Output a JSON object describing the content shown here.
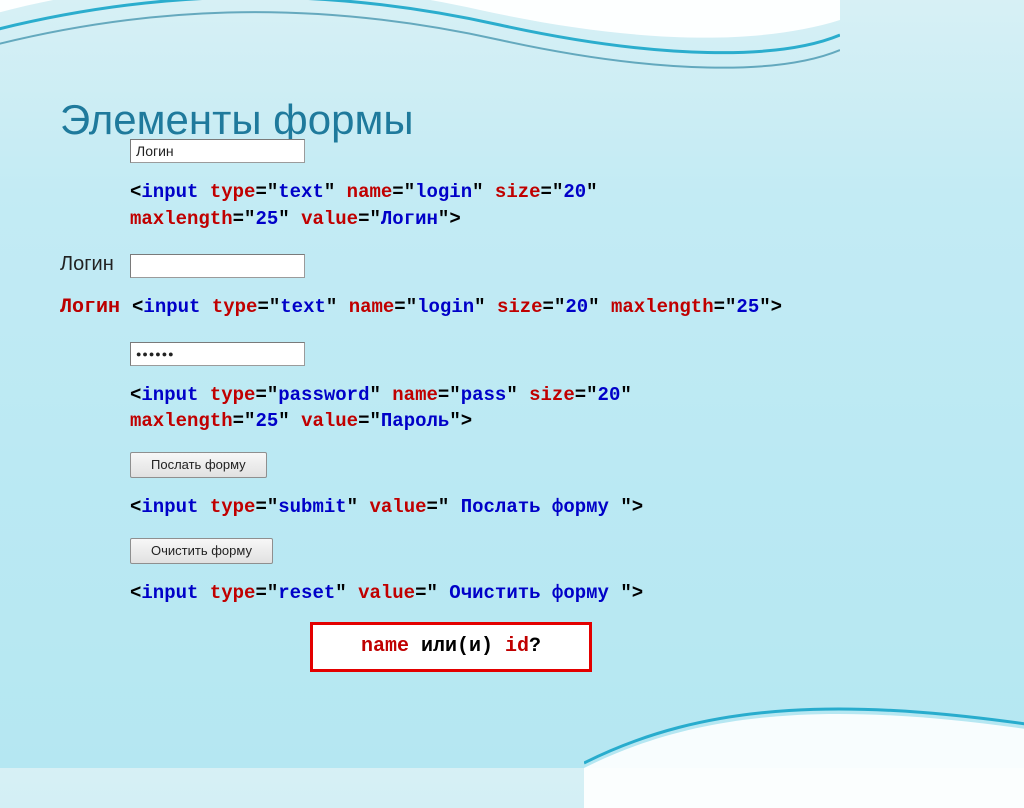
{
  "title": "Элементы формы",
  "example1": {
    "input_value": "Логин",
    "code": {
      "lt1": "<",
      "tag1": "input",
      "sp": " ",
      "a_type": "type",
      "eq": "=",
      "q": "\"",
      "v_type": "text",
      "a_name": "name",
      "v_name": "login",
      "a_size": "size",
      "v_size": "20",
      "a_maxlen": "maxlength",
      "v_maxlen": "25",
      "a_value": "value",
      "v_value": "Логин",
      "gt": ">"
    }
  },
  "example2": {
    "label": "Логин",
    "code_prefix": "Логин ",
    "code": {
      "lt1": "<",
      "tag1": "input",
      "a_type": "type",
      "v_type": "text",
      "a_name": "name",
      "v_name": "login",
      "a_size": "size",
      "v_size": "20",
      "a_maxlen": "maxlength",
      "v_maxlen": "25",
      "gt": ">"
    }
  },
  "example3": {
    "password_mask": "●●●●●●",
    "code": {
      "lt1": "<",
      "tag1": "input",
      "a_type": "type",
      "v_type": "password",
      "a_name": "name",
      "v_name": "pass",
      "a_size": "size",
      "v_size": "20",
      "a_maxlen": "maxlength",
      "v_maxlen": "25",
      "a_value": "value",
      "v_value": "Пароль",
      "gt": ">"
    }
  },
  "example4": {
    "button_label": "Послать форму",
    "code": {
      "lt1": "<",
      "tag1": "input",
      "a_type": "type",
      "v_type": "submit",
      "a_value": "value",
      "v_value": " Послать форму ",
      "gt": ">"
    }
  },
  "example5": {
    "button_label": "Очистить форму",
    "code": {
      "lt1": "<",
      "tag1": "input",
      "a_type": "type",
      "v_type": "reset",
      "a_value": "value",
      "v_value": " Очистить форму ",
      "gt": ">"
    }
  },
  "question": {
    "name": "name",
    "mid": " или(и) ",
    "id": "id",
    "qm": "?"
  },
  "punct": {
    "eq": "=",
    "q": "\"",
    "lt": "<",
    "gt": ">",
    "sp": " "
  }
}
